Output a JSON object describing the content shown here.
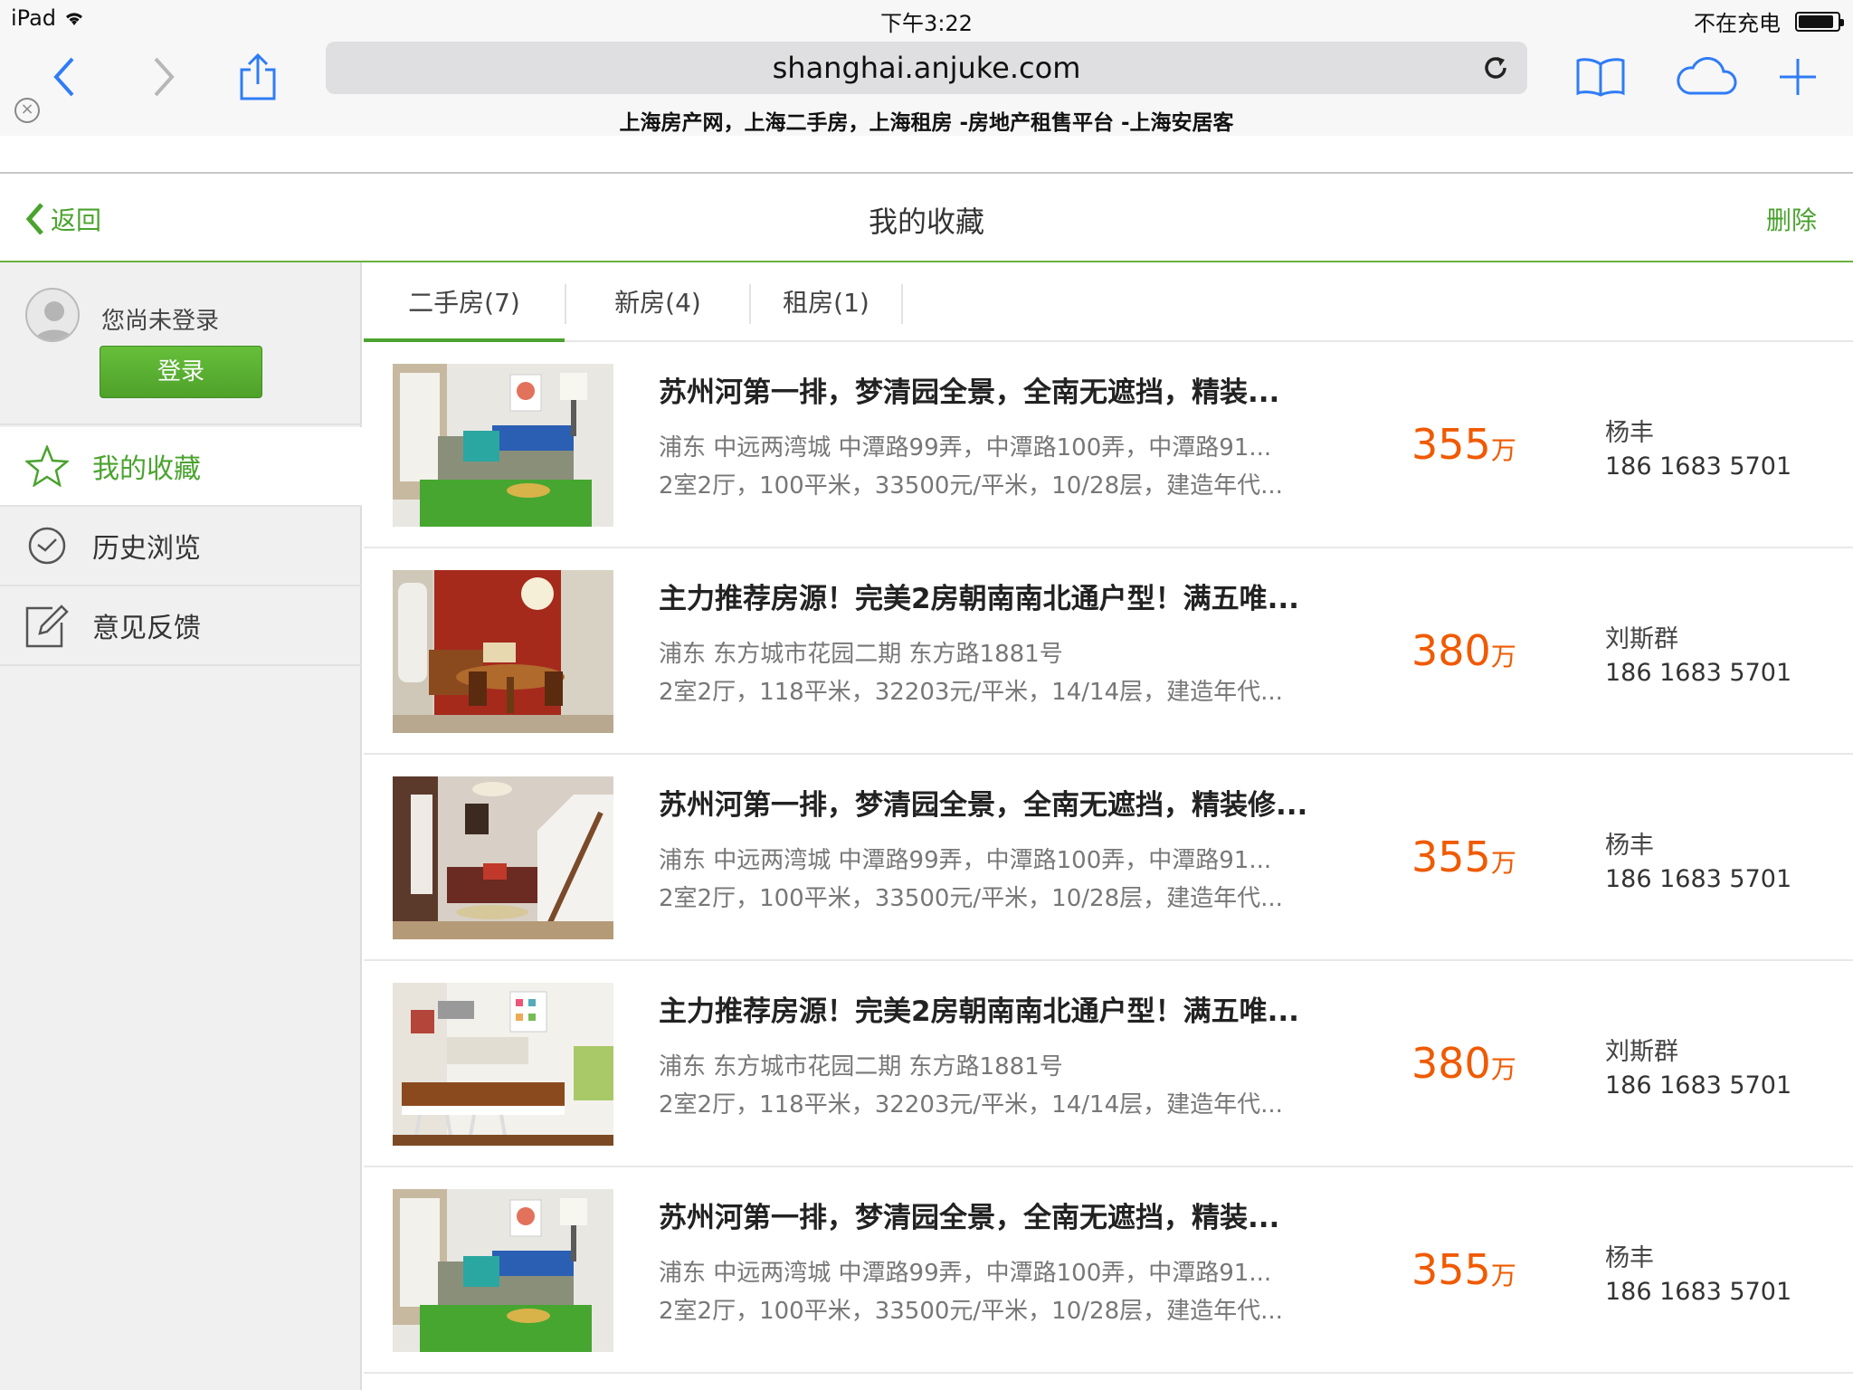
{
  "status_bar": {
    "device": "iPad",
    "time": "下午3:22",
    "charging": "不在充电"
  },
  "browser": {
    "url": "shanghai.anjuke.com",
    "page_title": "上海房产网，上海二手房，上海租房 -房地产租售平台 -上海安居客"
  },
  "header": {
    "back_label": "返回",
    "title": "我的收藏",
    "delete_label": "删除"
  },
  "sidebar": {
    "user_status": "您尚未登录",
    "login_label": "登录",
    "items": [
      {
        "label": "我的收藏",
        "icon": "star-icon",
        "active": true
      },
      {
        "label": "历史浏览",
        "icon": "history-icon",
        "active": false
      },
      {
        "label": "意见反馈",
        "icon": "feedback-icon",
        "active": false
      }
    ]
  },
  "tabs": [
    {
      "label": "二手房(7)",
      "active": true
    },
    {
      "label": "新房(4)",
      "active": false
    },
    {
      "label": "租房(1)",
      "active": false
    }
  ],
  "listings": [
    {
      "title": "苏州河第一排，梦清园全景，全南无遮挡，精装...",
      "address": "浦东 中远两湾城 中潭路99弄，中潭路100弄，中潭路91...",
      "info": "2室2厅，100平米，33500元/平米，10/28层，建造年代...",
      "price": "355",
      "unit": "万",
      "agent": "杨丰",
      "phone": "186 1683 5701"
    },
    {
      "title": "主力推荐房源！完美2房朝南南北通户型！满五唯...",
      "address": "浦东 东方城市花园二期  东方路1881号",
      "info": "2室2厅，118平米，32203元/平米，14/14层，建造年代...",
      "price": "380",
      "unit": "万",
      "agent": "刘斯群",
      "phone": "186 1683 5701"
    },
    {
      "title": "苏州河第一排，梦清园全景，全南无遮挡，精装修...",
      "address": "浦东 中远两湾城 中潭路99弄，中潭路100弄，中潭路91...",
      "info": "2室2厅，100平米，33500元/平米，10/28层，建造年代...",
      "price": "355",
      "unit": "万",
      "agent": "杨丰",
      "phone": "186 1683 5701"
    },
    {
      "title": "主力推荐房源！完美2房朝南南北通户型！满五唯...",
      "address": "浦东 东方城市花园二期  东方路1881号",
      "info": "2室2厅，118平米，32203元/平米，14/14层，建造年代...",
      "price": "380",
      "unit": "万",
      "agent": "刘斯群",
      "phone": "186 1683 5701"
    },
    {
      "title": "苏州河第一排，梦清园全景，全南无遮挡，精装...",
      "address": "浦东 中远两湾城 中潭路99弄，中潭路100弄，中潭路91...",
      "info": "2室2厅，100平米，33500元/平米，10/28层，建造年代...",
      "price": "355",
      "unit": "万",
      "agent": "杨丰",
      "phone": "186 1683 5701"
    }
  ],
  "colors": {
    "accent": "#4aa32e",
    "price": "#f05a00",
    "ios_blue": "#2f7cf6"
  }
}
